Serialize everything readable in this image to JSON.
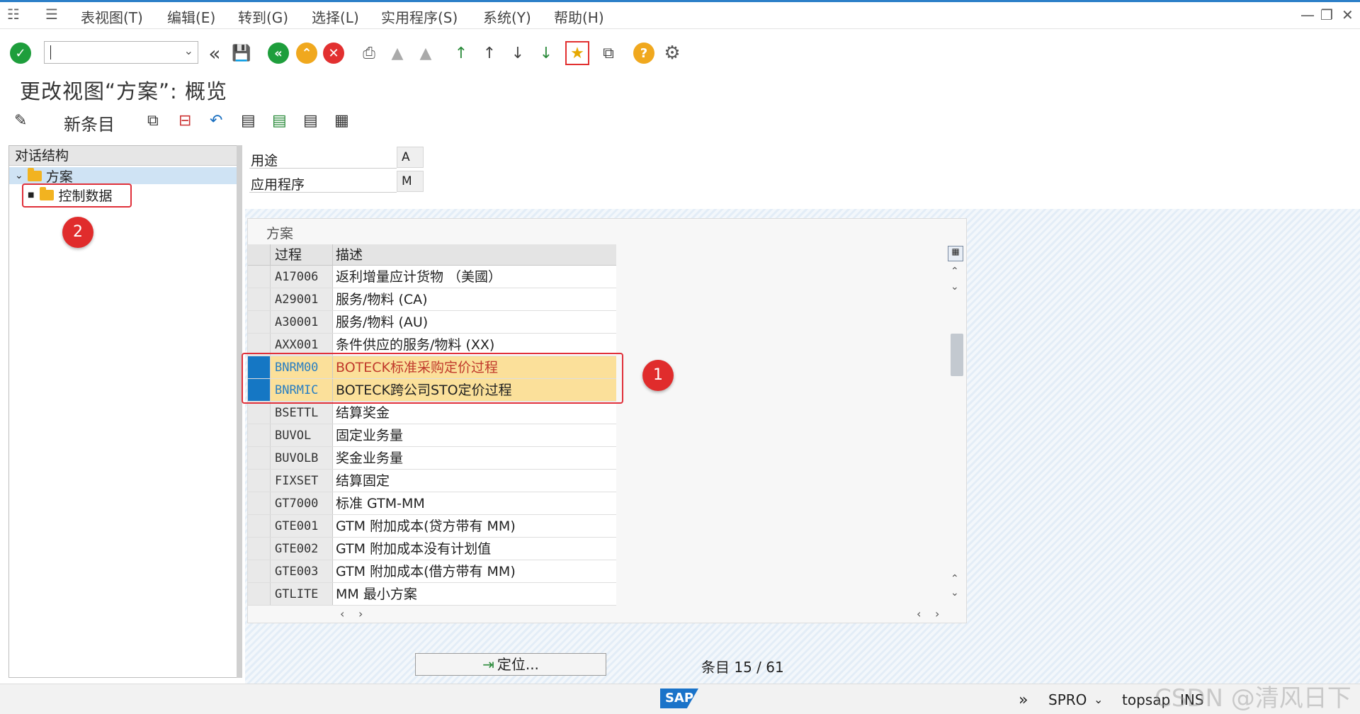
{
  "menu": {
    "items": [
      "表视图(T)",
      "编辑(E)",
      "转到(G)",
      "选择(L)",
      "实用程序(S)",
      "系统(Y)",
      "帮助(H)"
    ]
  },
  "toolbar": {
    "command_value": ""
  },
  "title": "更改视图“方案”: 概览",
  "app_toolbar": {
    "new_entry_label": "新条目"
  },
  "tree": {
    "header": "对话结构",
    "nodes": [
      {
        "label": "方案",
        "expanded": true,
        "selected": true
      },
      {
        "label": "控制数据",
        "expanded": false,
        "selected": false
      }
    ]
  },
  "fields": [
    {
      "label": "用途",
      "value": "A"
    },
    {
      "label": "应用程序",
      "value": "M"
    }
  ],
  "table": {
    "title": "方案",
    "columns": [
      "过程",
      "描述"
    ],
    "rows": [
      {
        "code": "A17006",
        "desc": "返利增量应计货物 （美國）",
        "selected": false
      },
      {
        "code": "A29001",
        "desc": "服务/物料 (CA)",
        "selected": false
      },
      {
        "code": "A30001",
        "desc": "服务/物料 (AU)",
        "selected": false
      },
      {
        "code": "AXX001",
        "desc": "条件供应的服务/物料 (XX)",
        "selected": false
      },
      {
        "code": "BNRM00",
        "desc": "BOTECK标准采购定价过程",
        "selected": true,
        "red": true
      },
      {
        "code": "BNRMIC",
        "desc": "BOTECK跨公司STO定价过程",
        "selected": true
      },
      {
        "code": "BSETTL",
        "desc": "结算奖金",
        "selected": false
      },
      {
        "code": "BUVOL",
        "desc": "固定业务量",
        "selected": false
      },
      {
        "code": "BUVOLB",
        "desc": "奖金业务量",
        "selected": false
      },
      {
        "code": "FIXSET",
        "desc": "结算固定",
        "selected": false
      },
      {
        "code": "GT7000",
        "desc": "标准 GTM-MM",
        "selected": false
      },
      {
        "code": "GTE001",
        "desc": "GTM 附加成本(贷方带有 MM)",
        "selected": false
      },
      {
        "code": "GTE002",
        "desc": "GTM 附加成本没有计划值",
        "selected": false
      },
      {
        "code": "GTE003",
        "desc": "GTM 附加成本(借方带有 MM)",
        "selected": false
      },
      {
        "code": "GTLITE",
        "desc": "MM 最小方案",
        "selected": false
      }
    ]
  },
  "annotations": {
    "badge1": "1",
    "badge2": "2"
  },
  "bottom": {
    "position_button": "定位...",
    "entry_label": "条目",
    "entry_current": "15",
    "entry_total": "61"
  },
  "status": {
    "transaction": "SPRO",
    "system": "topsap",
    "mode": "INS",
    "logo": "SAP"
  },
  "watermark": "CSDN @清风日下",
  "colors": {
    "accent": "#2c7fc8",
    "highlight_row": "#fbe09a",
    "selection": "#1577c4",
    "annotation": "#e0303a"
  }
}
